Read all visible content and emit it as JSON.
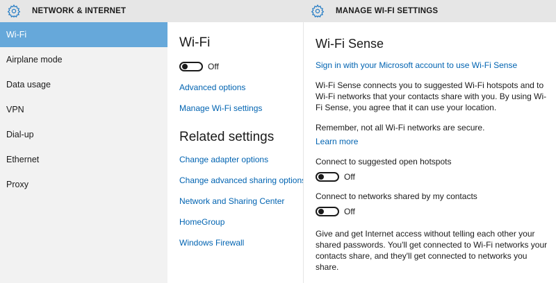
{
  "left": {
    "header_title": "NETWORK & INTERNET",
    "nav": [
      {
        "label": "Wi-Fi",
        "active": true
      },
      {
        "label": "Airplane mode",
        "active": false
      },
      {
        "label": "Data usage",
        "active": false
      },
      {
        "label": "VPN",
        "active": false
      },
      {
        "label": "Dial-up",
        "active": false
      },
      {
        "label": "Ethernet",
        "active": false
      },
      {
        "label": "Proxy",
        "active": false
      }
    ],
    "wifi_title": "Wi-Fi",
    "wifi_toggle_state": "Off",
    "advanced_options": "Advanced options",
    "manage_wifi": "Manage Wi-Fi settings",
    "related_title": "Related settings",
    "related_links": [
      "Change adapter options",
      "Change advanced sharing options",
      "Network and Sharing Center",
      "HomeGroup",
      "Windows Firewall"
    ]
  },
  "right": {
    "header_title": "MANAGE WI-FI SETTINGS",
    "sense_title": "Wi-Fi Sense",
    "sign_in_link": "Sign in with your Microsoft account to use Wi-Fi Sense",
    "description": "Wi-Fi Sense connects you to suggested Wi-Fi hotspots and to Wi-Fi networks that your contacts share with you. By using Wi-Fi Sense, you agree that it can use your location.",
    "warning": "Remember, not all Wi-Fi networks are secure.",
    "learn_more": "Learn more",
    "open_hotspots_label": "Connect to suggested open hotspots",
    "open_hotspots_state": "Off",
    "contacts_label": "Connect to networks shared by my contacts",
    "contacts_state": "Off",
    "footer": "Give and get Internet access without telling each other your shared passwords. You'll get connected to Wi-Fi networks your contacts share, and they'll get connected to networks you share."
  },
  "colors": {
    "accent": "#0063b1",
    "nav_active": "#66a8da",
    "header_bg": "#e6e6e6",
    "nav_bg": "#f2f2f2",
    "gear": "#2a7fc6"
  }
}
